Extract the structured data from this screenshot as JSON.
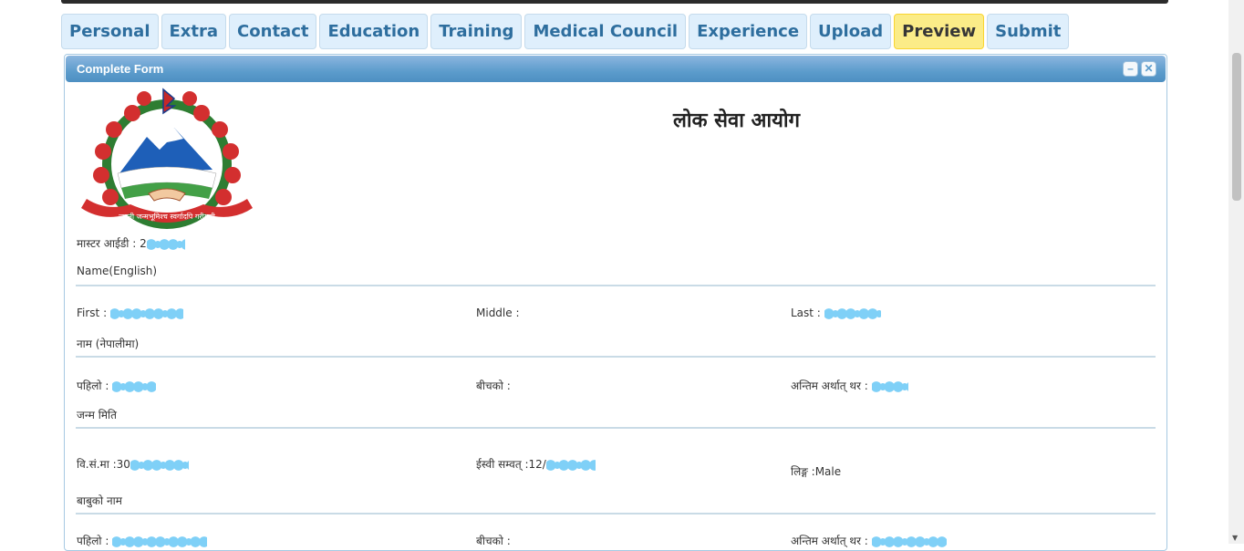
{
  "tabs": [
    {
      "label": "Personal"
    },
    {
      "label": "Extra"
    },
    {
      "label": "Contact"
    },
    {
      "label": "Education"
    },
    {
      "label": "Training"
    },
    {
      "label": "Medical Council"
    },
    {
      "label": "Experience"
    },
    {
      "label": "Upload"
    },
    {
      "label": "Preview",
      "active": true
    },
    {
      "label": "Submit"
    }
  ],
  "panel": {
    "title": "Complete Form",
    "minimize_icon": "minus-icon",
    "close_icon": "close-icon"
  },
  "form": {
    "org_title": "लोक सेवा आयोग",
    "emblem_motto": "जननी जन्मभूमिश्च स्वर्गादपि गरीयसी",
    "master_id_label": "मास्टर आईडी : 2",
    "name_english_heading": "Name(English)",
    "first_label": "First :",
    "middle_label": "Middle :",
    "last_label": "Last :",
    "name_nepali_heading": "नाम (नेपालीमा)",
    "pahilo_label": "पहिलो :",
    "bichko_label": "बीचको :",
    "antim_label": "अन्तिम अर्थात् थर :",
    "dob_heading": "जन्म मिति",
    "bs_label": "वि.सं.मा :30",
    "ad_label": "ईस्वी सम्वत् :12/",
    "gender_label": "लिङ्ग :Male",
    "father_heading": "बाबुको नाम",
    "father_first_label": "पहिलो :",
    "father_middle_label": "बीचको :",
    "father_last_label": "अन्तिम अर्थात् थर :"
  },
  "colors": {
    "tab_bg": "#dfeffc",
    "tab_text": "#2e6e9e",
    "tab_active_bg": "#fbec88",
    "header_bg": "#5c9ccc"
  }
}
